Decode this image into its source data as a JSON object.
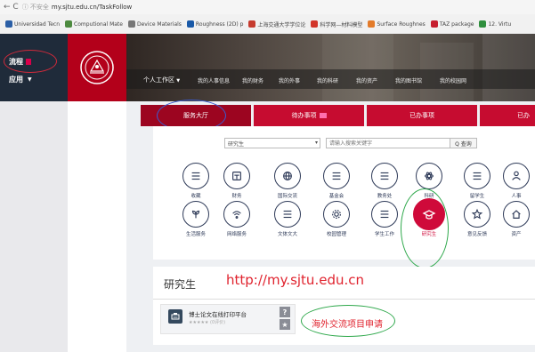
{
  "browser": {
    "nav": "← C",
    "security": "ⓘ 不安全",
    "url": "my.sjtu.edu.cn/TaskFollow",
    "bookmarks": [
      {
        "label": "Universidad Tecn",
        "color": "#2b5fa6"
      },
      {
        "label": "Computional Mate",
        "color": "#4c8a3f"
      },
      {
        "label": "Device Materials",
        "color": "#777777"
      },
      {
        "label": "Roughness (2D) p",
        "color": "#1a5aa8"
      },
      {
        "label": "上海交通大学学位论",
        "color": "#c63b2e"
      },
      {
        "label": "科学网—材料模型",
        "color": "#d2352a"
      },
      {
        "label": "Surface Roughnes",
        "color": "#e37b2a"
      },
      {
        "label": "TAZ package",
        "color": "#c61e2e"
      },
      {
        "label": "12. Virtu",
        "color": "#2f8f3d"
      }
    ]
  },
  "sidebar": {
    "items": [
      {
        "label": "流程",
        "badge": true
      },
      {
        "label": "应用",
        "caret": "▼"
      }
    ]
  },
  "menu": {
    "main": "个人工作区",
    "main_caret": "▼",
    "items": [
      "我的人事信息",
      "我的财务",
      "我的外事",
      "我的科研",
      "我的资产",
      "我的图书馆",
      "我的校园网"
    ]
  },
  "tabs": [
    {
      "label": "服务大厅",
      "active": true
    },
    {
      "label": "待办事项",
      "badge": true
    },
    {
      "label": "已办事项"
    },
    {
      "label": "已办"
    }
  ],
  "search": {
    "select_value": "研究生",
    "select_arrow": "▾",
    "placeholder": "请输入搜索关键字",
    "button_label": "Q 查询"
  },
  "services": [
    {
      "label": "收藏",
      "icon": "list"
    },
    {
      "label": "财务",
      "icon": "wallet"
    },
    {
      "label": "国际交流",
      "icon": "globe"
    },
    {
      "label": "基金会",
      "icon": "list"
    },
    {
      "label": "教务处",
      "icon": "list"
    },
    {
      "label": "科研",
      "icon": "atom"
    },
    {
      "label": "留学生",
      "icon": "list"
    },
    {
      "label": "人事",
      "icon": "person"
    },
    {
      "label": "生活服务",
      "icon": "leaf"
    },
    {
      "label": "网络服务",
      "icon": "wifi"
    },
    {
      "label": "文体文大",
      "icon": "list"
    },
    {
      "label": "校园管理",
      "icon": "gear"
    },
    {
      "label": "学生工作",
      "icon": "list"
    },
    {
      "label": "研究生",
      "icon": "cap",
      "active": true
    },
    {
      "label": "意见反馈",
      "icon": "star"
    },
    {
      "label": "资产",
      "icon": "home"
    }
  ],
  "section": {
    "title": "研究生",
    "url": "http://my.sjtu.edu.cn",
    "app": {
      "name": "博士论文在线打印平台",
      "rating": "★★★★★ (0评价)",
      "help": "?",
      "fav": "★"
    },
    "annotation": "海外交流项目申请"
  },
  "colors": {
    "accent": "#c60c30",
    "active_service": "#cf0a3a",
    "annotation_red": "#e0232e",
    "annotation_green": "#2ea84b",
    "annotation_blue": "#3a5bd0"
  }
}
